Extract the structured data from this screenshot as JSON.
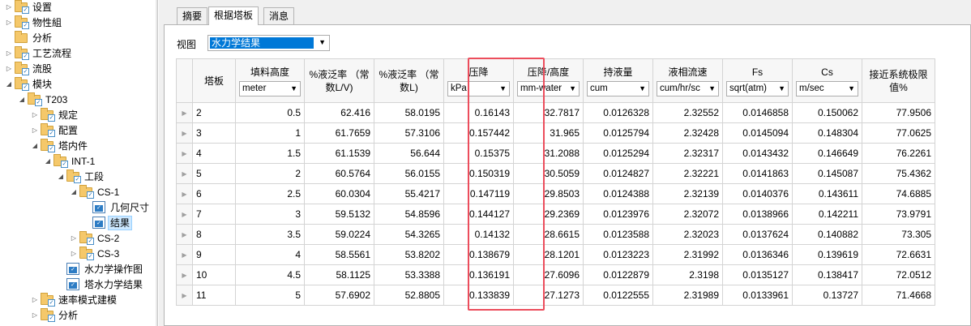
{
  "tree": [
    {
      "label": "设置",
      "level": 0,
      "icon": "folder-check-icon",
      "exp": "▷"
    },
    {
      "label": "物性組",
      "level": 0,
      "icon": "folder-check-icon",
      "exp": "▷"
    },
    {
      "label": "分析",
      "level": 0,
      "icon": "folder-icon",
      "exp": ""
    },
    {
      "label": "工艺流程",
      "level": 0,
      "icon": "folder-check-icon",
      "exp": "▷"
    },
    {
      "label": "流股",
      "level": 0,
      "icon": "folder-check-icon",
      "exp": "▷"
    },
    {
      "label": "模块",
      "level": 0,
      "icon": "folder-check-icon",
      "exp": "◢"
    },
    {
      "label": "T203",
      "level": 1,
      "icon": "folder-check-icon",
      "exp": "◢"
    },
    {
      "label": "规定",
      "level": 2,
      "icon": "folder-check-icon",
      "exp": "▷"
    },
    {
      "label": "配置",
      "level": 2,
      "icon": "folder-check-icon",
      "exp": "▷"
    },
    {
      "label": "塔内件",
      "level": 2,
      "icon": "folder-check-icon",
      "exp": "◢"
    },
    {
      "label": "INT-1",
      "level": 3,
      "icon": "folder-check-icon",
      "exp": "◢"
    },
    {
      "label": "工段",
      "level": 4,
      "icon": "folder-check-icon",
      "exp": "◢"
    },
    {
      "label": "CS-1",
      "level": 5,
      "icon": "folder-check-icon",
      "exp": "◢"
    },
    {
      "label": "几何尺寸",
      "level": 6,
      "icon": "form-check-icon",
      "exp": ""
    },
    {
      "label": "结果",
      "level": 6,
      "icon": "form-check-icon",
      "exp": "",
      "selected": true
    },
    {
      "label": "CS-2",
      "level": 5,
      "icon": "folder-check-icon",
      "exp": "▷"
    },
    {
      "label": "CS-3",
      "level": 5,
      "icon": "folder-check-icon",
      "exp": "▷"
    },
    {
      "label": "水力学操作图",
      "level": 4,
      "icon": "form-check-icon",
      "exp": ""
    },
    {
      "label": "塔水力学结果",
      "level": 4,
      "icon": "form-check-icon",
      "exp": ""
    },
    {
      "label": "速率模式建模",
      "level": 2,
      "icon": "folder-check-icon",
      "exp": "▷"
    },
    {
      "label": "分析",
      "level": 2,
      "icon": "folder-check-icon",
      "exp": "▷"
    }
  ],
  "tabs": [
    "摘要",
    "根据塔板",
    "消息"
  ],
  "active_tab": 1,
  "view": {
    "label": "视图",
    "value": "水力学结果"
  },
  "table": {
    "stage_header": "塔板",
    "columns": [
      {
        "title": "填料高度",
        "unit": "meter"
      },
      {
        "title": "%液泛率 （常数L/V)",
        "unit": ""
      },
      {
        "title": "%液泛率 （常数L)",
        "unit": ""
      },
      {
        "title": "压降",
        "unit": "kPa"
      },
      {
        "title": "压降/高度",
        "unit": "mm-water"
      },
      {
        "title": "持液量",
        "unit": "cum"
      },
      {
        "title": "液相流速",
        "unit": "cum/hr/sc"
      },
      {
        "title": "Fs",
        "unit": "sqrt(atm)"
      },
      {
        "title": "Cs",
        "unit": "m/sec"
      },
      {
        "title": "接近系统极限值%",
        "unit": ""
      }
    ],
    "rows": [
      [
        "2",
        "0.5",
        "62.416",
        "58.0195",
        "0.16143",
        "32.7817",
        "0.0126328",
        "2.32552",
        "0.0146858",
        "0.150062",
        "77.9506"
      ],
      [
        "3",
        "1",
        "61.7659",
        "57.3106",
        "0.157442",
        "31.965",
        "0.0125794",
        "2.32428",
        "0.0145094",
        "0.148304",
        "77.0625"
      ],
      [
        "4",
        "1.5",
        "61.1539",
        "56.644",
        "0.15375",
        "31.2088",
        "0.0125294",
        "2.32317",
        "0.0143432",
        "0.146649",
        "76.2261"
      ],
      [
        "5",
        "2",
        "60.5764",
        "56.0155",
        "0.150319",
        "30.5059",
        "0.0124827",
        "2.32221",
        "0.0141863",
        "0.145087",
        "75.4362"
      ],
      [
        "6",
        "2.5",
        "60.0304",
        "55.4217",
        "0.147119",
        "29.8503",
        "0.0124388",
        "2.32139",
        "0.0140376",
        "0.143611",
        "74.6885"
      ],
      [
        "7",
        "3",
        "59.5132",
        "54.8596",
        "0.144127",
        "29.2369",
        "0.0123976",
        "2.32072",
        "0.0138966",
        "0.142211",
        "73.9791"
      ],
      [
        "8",
        "3.5",
        "59.0224",
        "54.3265",
        "0.14132",
        "28.6615",
        "0.0123588",
        "2.32023",
        "0.0137624",
        "0.140882",
        "73.305"
      ],
      [
        "9",
        "4",
        "58.5561",
        "53.8202",
        "0.138679",
        "28.1201",
        "0.0123223",
        "2.31992",
        "0.0136346",
        "0.139619",
        "72.6631"
      ],
      [
        "10",
        "4.5",
        "58.1125",
        "53.3388",
        "0.136191",
        "27.6096",
        "0.0122879",
        "2.3198",
        "0.0135127",
        "0.138417",
        "72.0512"
      ],
      [
        "11",
        "5",
        "57.6902",
        "52.8805",
        "0.133839",
        "27.1273",
        "0.0122555",
        "2.31989",
        "0.0133961",
        "0.13727",
        "71.4668"
      ]
    ]
  },
  "highlight_color": "#ec4d5c"
}
